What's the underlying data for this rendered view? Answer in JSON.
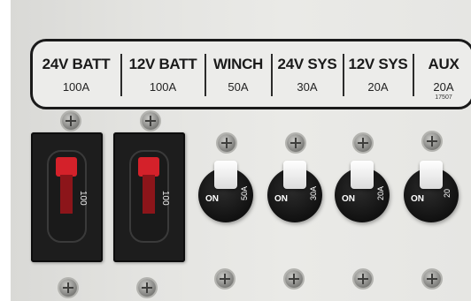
{
  "panel": {
    "circuits": [
      {
        "name": "24V BATT",
        "rating": "100A"
      },
      {
        "name": "12V BATT",
        "rating": "100A"
      },
      {
        "name": "WINCH",
        "rating": "50A"
      },
      {
        "name": "24V SYS",
        "rating": "30A"
      },
      {
        "name": "12V SYS",
        "rating": "20A"
      },
      {
        "name": "AUX",
        "rating": "20A"
      }
    ],
    "part_number": "17507",
    "breakers": [
      {
        "rating_mark": "100"
      },
      {
        "rating_mark": "100"
      }
    ],
    "toggles": [
      {
        "on_label": "ON",
        "rating_mark": "50A"
      },
      {
        "on_label": "ON",
        "rating_mark": "30A"
      },
      {
        "on_label": "ON",
        "rating_mark": "20A"
      },
      {
        "on_label": "ON",
        "rating_mark": "20"
      }
    ]
  },
  "colors": {
    "panel": "#e6e6e3",
    "label_border": "#1a1a1a",
    "breaker_body": "#1d1d1d",
    "breaker_lever": "#d4212a",
    "toggle_paddle": "#ffffff"
  }
}
